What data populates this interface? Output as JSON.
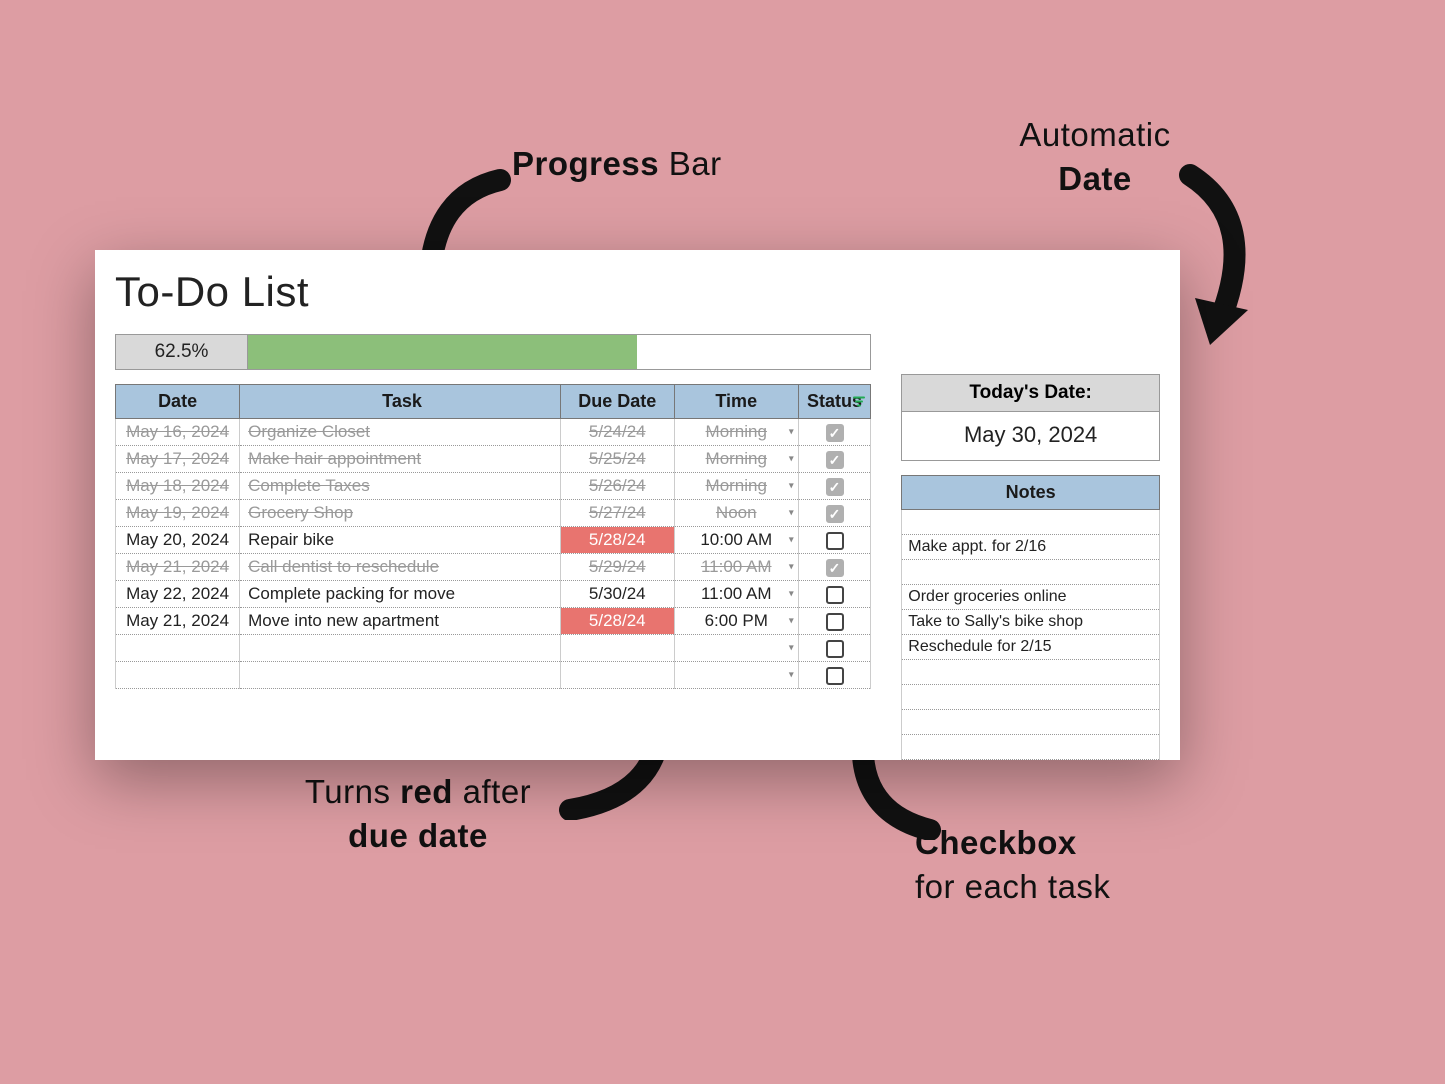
{
  "title": "To-Do List",
  "progress": {
    "percent_label": "62.5%",
    "percent": 62.5
  },
  "today_box": {
    "header": "Today's Date:",
    "value": "May 30, 2024"
  },
  "headers": {
    "date": "Date",
    "task": "Task",
    "due": "Due Date",
    "time": "Time",
    "status": "Status",
    "notes": "Notes"
  },
  "rows": [
    {
      "date": "May 16, 2024",
      "task": "Organize Closet",
      "due": "5/24/24",
      "time": "Morning",
      "done": true,
      "overdue": false
    },
    {
      "date": "May 17, 2024",
      "task": "Make hair appointment",
      "due": "5/25/24",
      "time": "Morning",
      "done": true,
      "overdue": false
    },
    {
      "date": "May 18, 2024",
      "task": "Complete Taxes",
      "due": "5/26/24",
      "time": "Morning",
      "done": true,
      "overdue": false
    },
    {
      "date": "May 19, 2024",
      "task": "Grocery Shop",
      "due": "5/27/24",
      "time": "Noon",
      "done": true,
      "overdue": false
    },
    {
      "date": "May 20, 2024",
      "task": "Repair bike",
      "due": "5/28/24",
      "time": "10:00 AM",
      "done": false,
      "overdue": true
    },
    {
      "date": "May 21, 2024",
      "task": "Call dentist to reschedule",
      "due": "5/29/24",
      "time": "11:00 AM",
      "done": true,
      "overdue": false
    },
    {
      "date": "May 22, 2024",
      "task": "Complete packing for move",
      "due": "5/30/24",
      "time": "11:00 AM",
      "done": false,
      "overdue": false
    },
    {
      "date": "May 21, 2024",
      "task": "Move into new apartment",
      "due": "5/28/24",
      "time": "6:00 PM",
      "done": false,
      "overdue": true
    },
    {
      "date": "",
      "task": "",
      "due": "",
      "time": "",
      "done": false,
      "overdue": false,
      "blank": true
    },
    {
      "date": "",
      "task": "",
      "due": "",
      "time": "",
      "done": false,
      "overdue": false,
      "blank": true
    }
  ],
  "notes": [
    "",
    "Make appt. for 2/16",
    "",
    "Order groceries online",
    "Take to Sally's bike shop",
    "Reschedule for 2/15",
    "",
    "",
    "",
    ""
  ],
  "annotations": {
    "progress_bar": {
      "bold": "Progress",
      "rest": " Bar"
    },
    "auto_date": {
      "line1": "Automatic",
      "bold": "Date"
    },
    "turns_red": {
      "pre": "Turns ",
      "bold1": "red",
      "mid": " after",
      "bold2": "due date"
    },
    "checkbox": {
      "bold": "Checkbox",
      "rest": "for each task"
    }
  }
}
